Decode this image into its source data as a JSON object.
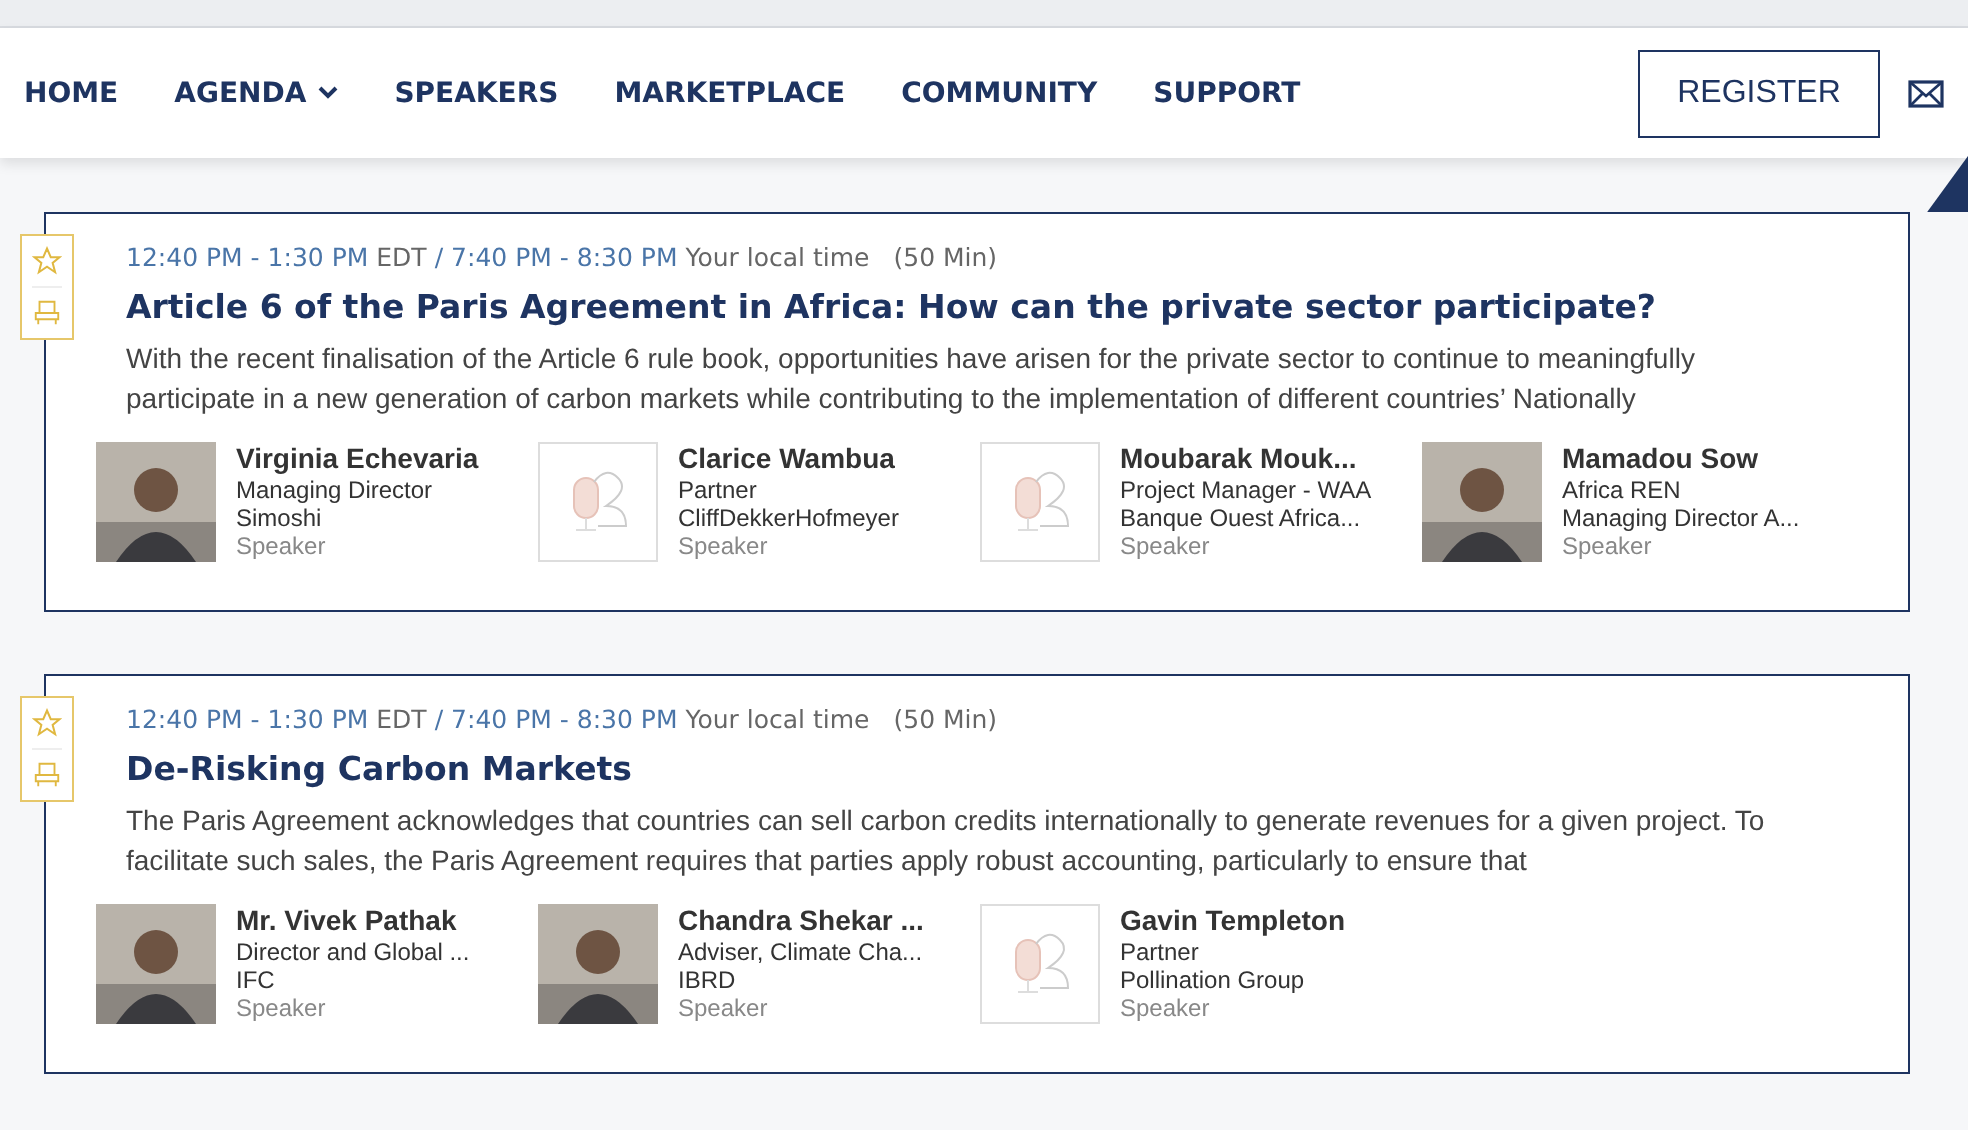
{
  "nav": {
    "items": [
      {
        "label": "HOME",
        "has_menu": false
      },
      {
        "label": "AGENDA",
        "has_menu": true
      },
      {
        "label": "SPEAKERS",
        "has_menu": false
      },
      {
        "label": "MARKETPLACE",
        "has_menu": false
      },
      {
        "label": "COMMUNITY",
        "has_menu": false
      },
      {
        "label": "SUPPORT",
        "has_menu": false
      }
    ],
    "register": "REGISTER"
  },
  "sessions": [
    {
      "event_time": "12:40 PM - 1:30 PM",
      "event_zone": "EDT",
      "separator": "/",
      "local_time": "7:40 PM - 8:30 PM",
      "local_label": "Your local time",
      "duration": "(50 Min)",
      "title": "Article 6 of the Paris Agreement in Africa: How can the private sector participate?",
      "description": "With the recent finalisation of the Article 6 rule book, opportunities have arisen for the private sector to continue to meaningfully participate in a new generation of carbon markets while contributing to the implementation of different countries’ Nationally",
      "speakers": [
        {
          "name": "Virginia Echevaria",
          "line_1": "Managing Director",
          "line_2": "Simoshi",
          "role": "Speaker"
        },
        {
          "kind": "placeholder",
          "name": "Clarice Wambua",
          "line_1": "Partner",
          "line_2": "CliffDekkerHofmeyer",
          "role": "Speaker"
        },
        {
          "kind": "placeholder",
          "name": "Moubarak Mouk...",
          "line_1": "Project Manager - WAA",
          "line_2": "Banque Ouest Africa...",
          "role": "Speaker"
        },
        {
          "name": "Mamadou Sow",
          "line_1": "Africa REN",
          "line_2": "Managing Director A...",
          "role": "Speaker"
        }
      ]
    },
    {
      "event_time": "12:40 PM - 1:30 PM",
      "event_zone": "EDT",
      "separator": "/",
      "local_time": "7:40 PM - 8:30 PM",
      "local_label": "Your local time",
      "duration": "(50 Min)",
      "title": "De-Risking Carbon Markets",
      "description": "The Paris Agreement acknowledges that countries can sell carbon credits internationally to generate revenues for a given project. To facilitate such sales, the Paris Agreement requires that parties apply robust accounting, particularly to ensure that",
      "speakers": [
        {
          "name": "Mr. Vivek Pathak",
          "line_1": "Director and Global ...",
          "line_2": "IFC",
          "role": "Speaker"
        },
        {
          "name": "Chandra Shekar ...",
          "line_1": "Adviser, Climate Cha...",
          "line_2": "IBRD",
          "role": "Speaker"
        },
        {
          "kind": "placeholder",
          "name": "Gavin Templeton",
          "line_1": "Partner",
          "line_2": "Pollination Group",
          "role": "Speaker"
        }
      ]
    }
  ]
}
